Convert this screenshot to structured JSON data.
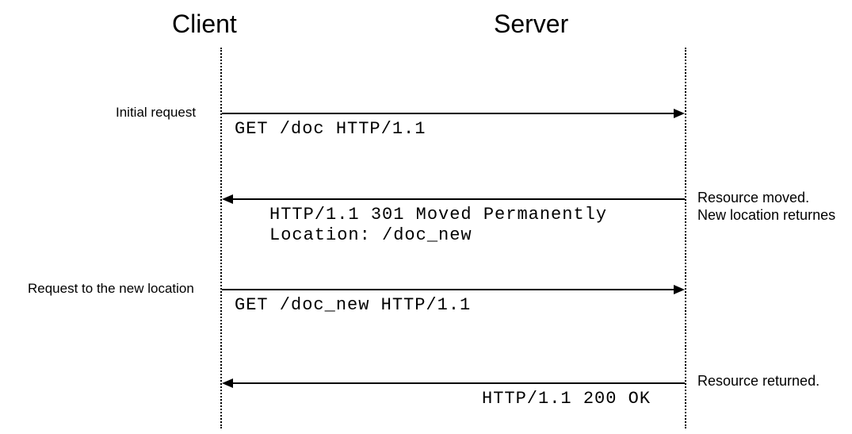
{
  "participants": {
    "client": "Client",
    "server": "Server"
  },
  "messages": {
    "msg1": {
      "note": "Initial request",
      "text": "GET /doc HTTP/1.1"
    },
    "msg2": {
      "note_line1": "Resource moved.",
      "note_line2": "New location returnes",
      "text_line1": "HTTP/1.1 301 Moved Permanently",
      "text_line2": "Location: /doc_new"
    },
    "msg3": {
      "note": "Request to the new location",
      "text": "GET /doc_new HTTP/1.1"
    },
    "msg4": {
      "note": "Resource returned.",
      "text": "HTTP/1.1 200 OK"
    }
  }
}
